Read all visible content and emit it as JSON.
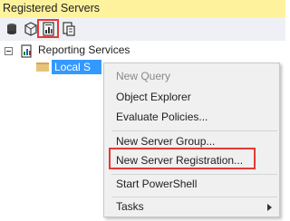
{
  "window": {
    "title": "Registered Servers"
  },
  "toolbar": {
    "buttons": [
      {
        "icon": "database-engine-icon"
      },
      {
        "icon": "analysis-services-icon"
      },
      {
        "icon": "reporting-services-icon",
        "highlighted": true
      },
      {
        "icon": "integration-services-icon"
      }
    ]
  },
  "tree": {
    "root": {
      "label": "Reporting Services",
      "expanded": true
    },
    "selected_node": {
      "label": "Local S"
    }
  },
  "context_menu": {
    "items": [
      {
        "label": "New Query",
        "enabled": false
      },
      {
        "label": "Object Explorer",
        "enabled": true
      },
      {
        "label": "Evaluate Policies...",
        "enabled": true
      },
      {
        "label": "New Server Group...",
        "enabled": true
      },
      {
        "label": "New Server Registration...",
        "enabled": true,
        "highlighted": true
      },
      {
        "label": "Start PowerShell",
        "enabled": true
      },
      {
        "label": "Tasks",
        "enabled": true,
        "submenu": true
      }
    ]
  },
  "colors": {
    "title_bar": "#fff29d",
    "selection": "#3399ff",
    "highlight_box": "#e53935"
  }
}
